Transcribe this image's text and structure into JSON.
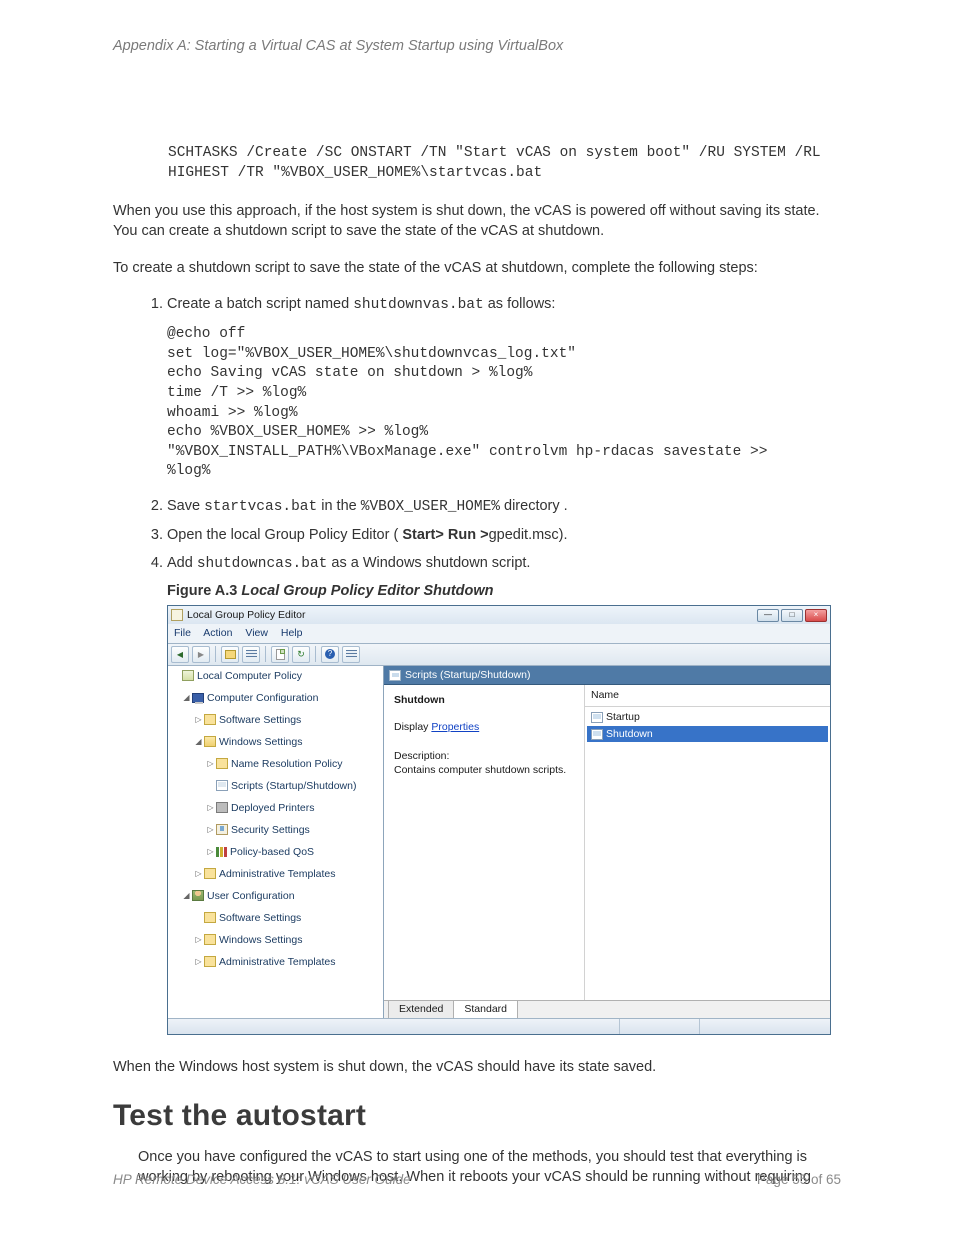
{
  "header": {
    "appendix": "Appendix A: Starting a Virtual CAS at System Startup using VirtualBox"
  },
  "code1": "SCHTASKS /Create /SC ONSTART /TN \"Start vCAS on system boot\" /RU SYSTEM /RL\nHIGHEST /TR \"%VBOX_USER_HOME%\\startvcas.bat",
  "p1": "When you use this approach, if the host system is shut down, the vCAS is powered off without saving its state. You can create a shutdown script to save the state of the vCAS at shutdown.",
  "p2": "To create a shutdown script to save the state of the vCAS at shutdown, complete the following steps:",
  "steps": {
    "s1_pre": "Create a batch script named ",
    "s1_code": "shutdownvas.bat",
    "s1_post": " as follows:",
    "s1_block": "@echo off\nset log=\"%VBOX_USER_HOME%\\shutdownvcas_log.txt\"\necho Saving vCAS state on shutdown > %log%\ntime /T >> %log%\nwhoami >> %log%\necho %VBOX_USER_HOME% >> %log%\n\"%VBOX_INSTALL_PATH%\\VBoxManage.exe\" controlvm hp-rdacas savestate >>\n%log%",
    "s2_pre": "Save ",
    "s2_code1": "startvcas.bat",
    "s2_mid": " in the ",
    "s2_code2": "%VBOX_USER_HOME%",
    "s2_post": " directory .",
    "s3_pre": "Open the local Group Policy Editor ( ",
    "s3_bold": "Start> Run >",
    "s3_post": "gpedit.msc).",
    "s4_pre": "Add ",
    "s4_code": "shutdowncas.bat",
    "s4_post": " as a Windows shutdown script.",
    "fig_label": "Figure A.3 ",
    "fig_title": "Local Group Policy Editor Shutdown"
  },
  "gp": {
    "title": "Local Group Policy Editor",
    "menu": {
      "file": "File",
      "action": "Action",
      "view": "View",
      "help": "Help"
    },
    "tree": {
      "root": "Local Computer Policy",
      "comp_cfg": "Computer Configuration",
      "sw1": "Software Settings",
      "win1": "Windows Settings",
      "nrp": "Name Resolution Policy",
      "scripts": "Scripts (Startup/Shutdown)",
      "printers": "Deployed Printers",
      "sec": "Security Settings",
      "qos": "Policy-based QoS",
      "admin1": "Administrative Templates",
      "user_cfg": "User Configuration",
      "sw2": "Software Settings",
      "win2": "Windows Settings",
      "admin2": "Administrative Templates"
    },
    "content": {
      "header": "Scripts (Startup/Shutdown)",
      "title": "Shutdown",
      "display": "Display ",
      "properties": "Properties",
      "desc_label": "Description:",
      "desc": "Contains computer shutdown scripts.",
      "col_name": "Name",
      "item_startup": "Startup",
      "item_shutdown": "Shutdown",
      "tab_ext": "Extended",
      "tab_std": "Standard"
    }
  },
  "after_fig": "When the Windows host system is shut down, the vCAS should have its state saved.",
  "h2": "Test the autostart",
  "p3": "Once you have configured the vCAS to start using one of the methods, you should test that everything is working by rebooting your Windows host. When it reboots your vCAS should be running without requiring",
  "footer": {
    "doc": "HP Remote Device Access 8.1: vCAS User Guide",
    "page": "Page 55 of 65"
  }
}
